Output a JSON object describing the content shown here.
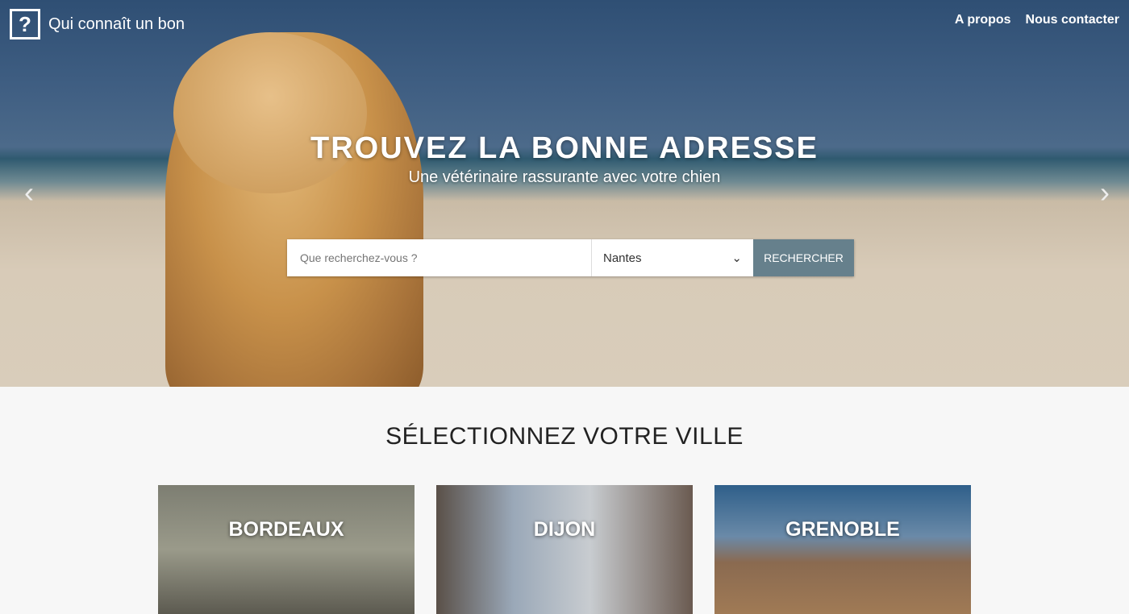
{
  "nav": {
    "brand": "Qui connaît un bon",
    "logo_glyph": "?",
    "links": [
      "A propos",
      "Nous contacter"
    ]
  },
  "hero": {
    "title": "TROUVEZ LA BONNE ADRESSE",
    "subtitle": "Une vétérinaire rassurante avec votre chien",
    "prev": "‹",
    "next": "›"
  },
  "search": {
    "placeholder": "Que recherchez-vous ?",
    "city": "Nantes",
    "button": "RECHERCHER",
    "chevron": "⌄"
  },
  "cities_section": {
    "title": "SÉLECTIONNEZ VOTRE VILLE",
    "cities": [
      {
        "name": "BORDEAUX",
        "color": "#8f8e7e"
      },
      {
        "name": "DIJON",
        "color": "#8a98a8"
      },
      {
        "name": "GRENOBLE",
        "color": "#6f7f8c"
      }
    ]
  }
}
